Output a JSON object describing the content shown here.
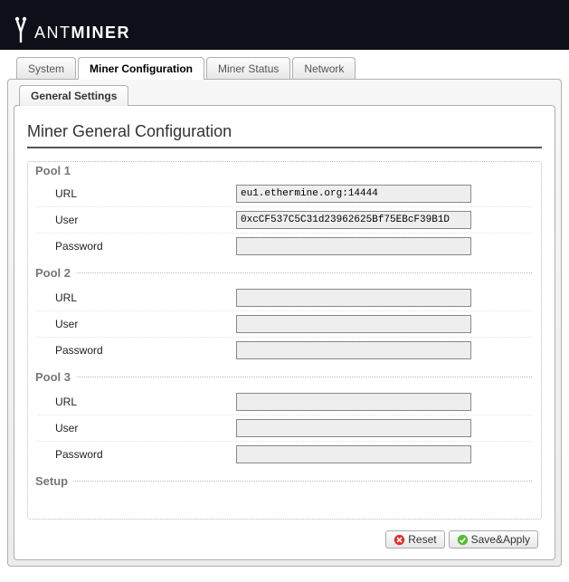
{
  "brand": {
    "first": "ANT",
    "second": "MINER"
  },
  "tabs": {
    "system": "System",
    "miner_config": "Miner Configuration",
    "miner_status": "Miner Status",
    "network": "Network"
  },
  "subtab": {
    "general": "General Settings"
  },
  "page_title": "Miner General Configuration",
  "labels": {
    "url": "URL",
    "user": "User",
    "password": "Password"
  },
  "pools": [
    {
      "legend": "Pool 1",
      "url": "eu1.ethermine.org:14444",
      "user": "0xcCF537C5C31d23962625Bf75EBcF39B1D",
      "password": ""
    },
    {
      "legend": "Pool 2",
      "url": "",
      "user": "",
      "password": ""
    },
    {
      "legend": "Pool 3",
      "url": "",
      "user": "",
      "password": ""
    }
  ],
  "setup_legend": "Setup",
  "buttons": {
    "reset": "Reset",
    "save": "Save&Apply"
  }
}
